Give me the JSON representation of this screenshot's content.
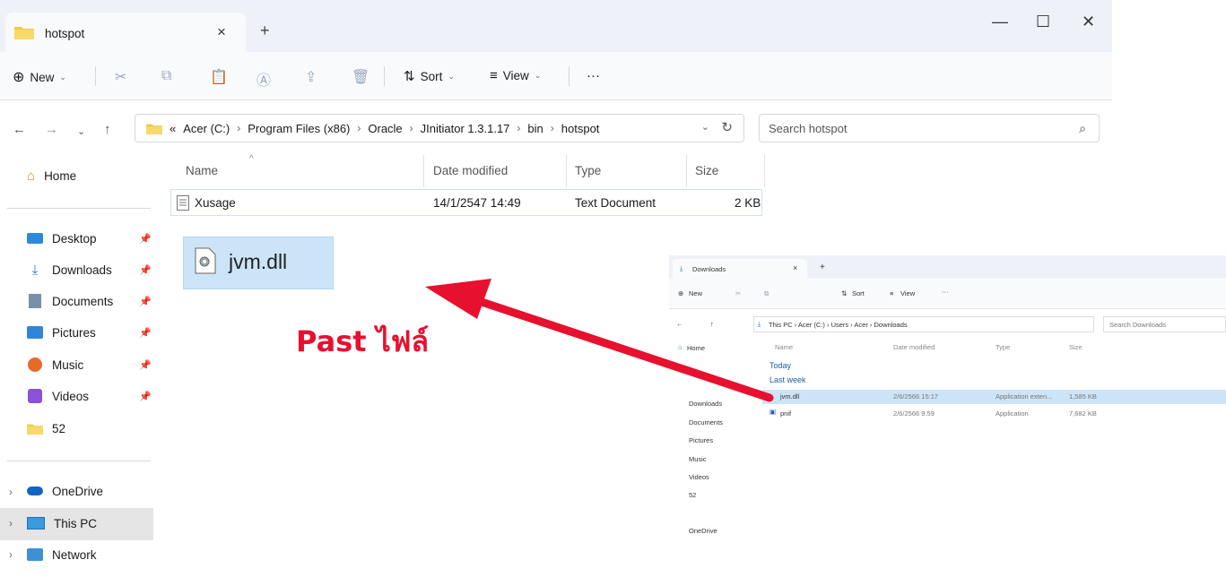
{
  "window": {
    "tab_title": "hotspot",
    "tab_close": "×",
    "new_tab": "+",
    "minimize": "—",
    "maximize": "☐",
    "close": "✕"
  },
  "toolbar": {
    "new_label": "New",
    "sort_label": "Sort",
    "view_label": "View",
    "more_label": "···"
  },
  "address": {
    "overflow": "«",
    "crumbs": [
      "Acer (C:)",
      "Program Files (x86)",
      "Oracle",
      "JInitiator 1.3.1.17",
      "bin",
      "hotspot"
    ],
    "search_placeholder": "Search hotspot"
  },
  "sidebar": {
    "home": "Home",
    "quick": [
      {
        "label": "Desktop",
        "icon": "desktop-icon"
      },
      {
        "label": "Downloads",
        "icon": "download-icon"
      },
      {
        "label": "Documents",
        "icon": "documents-icon"
      },
      {
        "label": "Pictures",
        "icon": "pictures-icon"
      },
      {
        "label": "Music",
        "icon": "music-icon"
      },
      {
        "label": "Videos",
        "icon": "videos-icon"
      },
      {
        "label": "52",
        "icon": "folder-icon"
      }
    ],
    "onedrive": "OneDrive",
    "thispc": "This PC",
    "network": "Network"
  },
  "files": {
    "columns": [
      "Name",
      "Date modified",
      "Type",
      "Size"
    ],
    "rows": [
      {
        "name": "Xusage",
        "date": "14/1/2547 14:49",
        "type": "Text Document",
        "size": "2 KB"
      }
    ],
    "pasted_file": "jvm.dll"
  },
  "annotation": "Past ไฟล์",
  "inset": {
    "tab_title": "Downloads",
    "new_label": "New",
    "sort_label": "Sort",
    "view_label": "View",
    "crumbs": "This PC  ›  Acer (C:)  ›  Users  ›  Acer  ›  Downloads",
    "search_placeholder": "Search Downloads",
    "columns": [
      "Name",
      "Date modified",
      "Type",
      "Size"
    ],
    "groups": [
      "Today",
      "Last week"
    ],
    "rows": [
      {
        "name": "jvm.dll",
        "date": "2/6/2566 15:17",
        "type": "Application exten...",
        "size": "1,585 KB"
      },
      {
        "name": "pnif",
        "date": "2/6/2566 9:59",
        "type": "Application",
        "size": "7,682 KB"
      }
    ],
    "side": [
      "Home",
      "Downloads",
      "Documents",
      "Pictures",
      "Music",
      "Videos",
      "52",
      "OneDrive"
    ]
  },
  "colors": {
    "accent_annotation": "#e8102f",
    "selection": "#cce4f7",
    "folder": "#f2c94c"
  }
}
